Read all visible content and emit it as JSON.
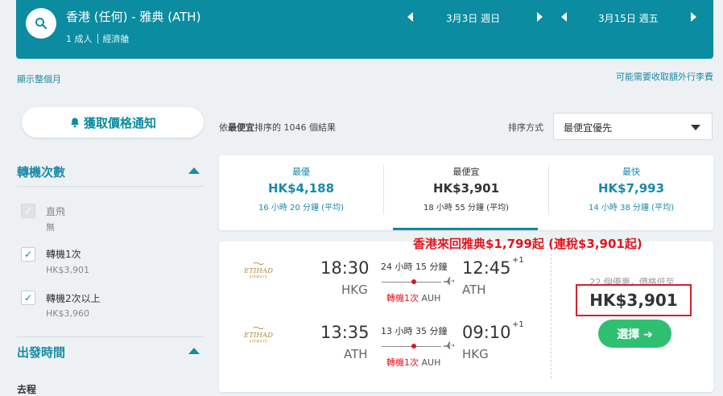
{
  "header": {
    "route": "香港 (任何) - 雅典 (ATH)",
    "passengers": "1 成人",
    "cabin": "經濟艙",
    "depart_date": "3月3日 週日",
    "return_date": "3月15日 週五"
  },
  "links": {
    "show_month": "顯示整個月",
    "extra_baggage": "可能需要收取額外行李費"
  },
  "sidebar": {
    "alert_button": "獲取價格通知",
    "stops_title": "轉機次數",
    "stops": [
      {
        "label": "直飛",
        "price": "無",
        "checked": true,
        "disabled": true
      },
      {
        "label": "轉機1次",
        "price": "HK$3,901",
        "checked": true,
        "disabled": false
      },
      {
        "label": "轉機2次以上",
        "price": "HK$3,960",
        "checked": true,
        "disabled": false
      }
    ],
    "departure_title": "出發時間",
    "outbound_label": "去程"
  },
  "results": {
    "count_prefix": "依",
    "count_bold": "最便宜",
    "count_suffix": "排序的 1046 個結果",
    "sort_label": "排序方式",
    "sort_value": "最便宜優先"
  },
  "tabs": [
    {
      "label": "最優",
      "price": "HK$4,188",
      "duration": "16 小時 20 分鐘 (平均)"
    },
    {
      "label": "最便宜",
      "price": "HK$3,901",
      "duration": "18 小時 55 分鐘 (平均)"
    },
    {
      "label": "最快",
      "price": "HK$7,993",
      "duration": "14 小時 38 分鐘 (平均)"
    }
  ],
  "promo": "香港來回雅典$1,799起 (連稅$3,901起)",
  "result": {
    "airline": "ETIHAD",
    "airline_sub": "AIRWAYS",
    "legs": [
      {
        "depart": "18:30",
        "from": "HKG",
        "duration": "24 小時 15 分鐘",
        "stops": "轉機1次",
        "hub": "AUH",
        "arrive": "12:45",
        "plus": "+1",
        "to": "ATH"
      },
      {
        "depart": "13:35",
        "from": "ATH",
        "duration": "13 小時 35 分鐘",
        "stops": "轉機1次",
        "hub": "AUH",
        "arrive": "09:10",
        "plus": "+1",
        "to": "HKG"
      }
    ],
    "deals": "22 個優惠，價格低至",
    "price": "HK$3,901",
    "select": "選擇 ➔"
  },
  "colors": {
    "brand": "#0b8ca0",
    "accent_red": "#e0161f",
    "select_green": "#2fbf71"
  }
}
